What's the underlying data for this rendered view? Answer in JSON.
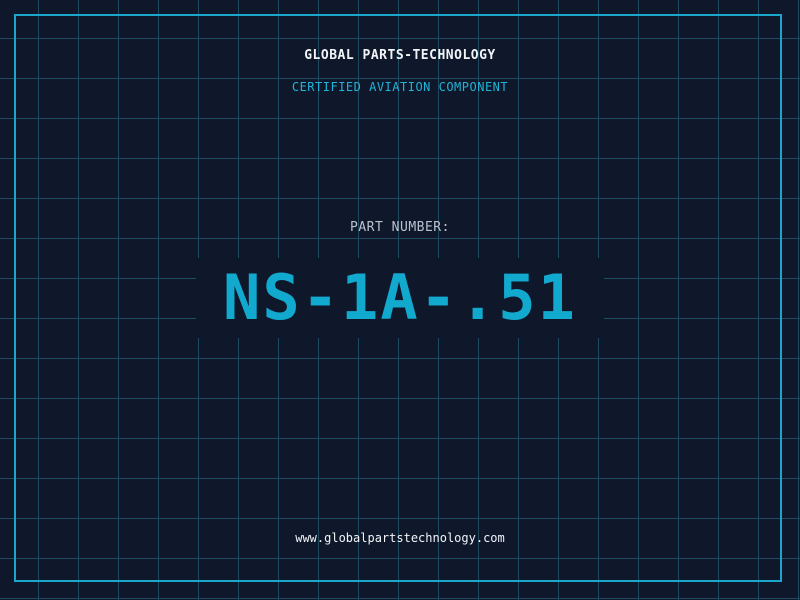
{
  "header": {
    "company": "GLOBAL PARTS-TECHNOLOGY",
    "subtitle": "CERTIFIED AVIATION COMPONENT"
  },
  "part": {
    "label": "PART NUMBER:",
    "number": "NS-1A-.51"
  },
  "footer": {
    "website": "www.globalpartstechnology.com"
  },
  "colors": {
    "background": "#0f172a",
    "grid": "#1e4a5f",
    "accent": "#1ba6cc",
    "text": "#f1f5f9"
  }
}
